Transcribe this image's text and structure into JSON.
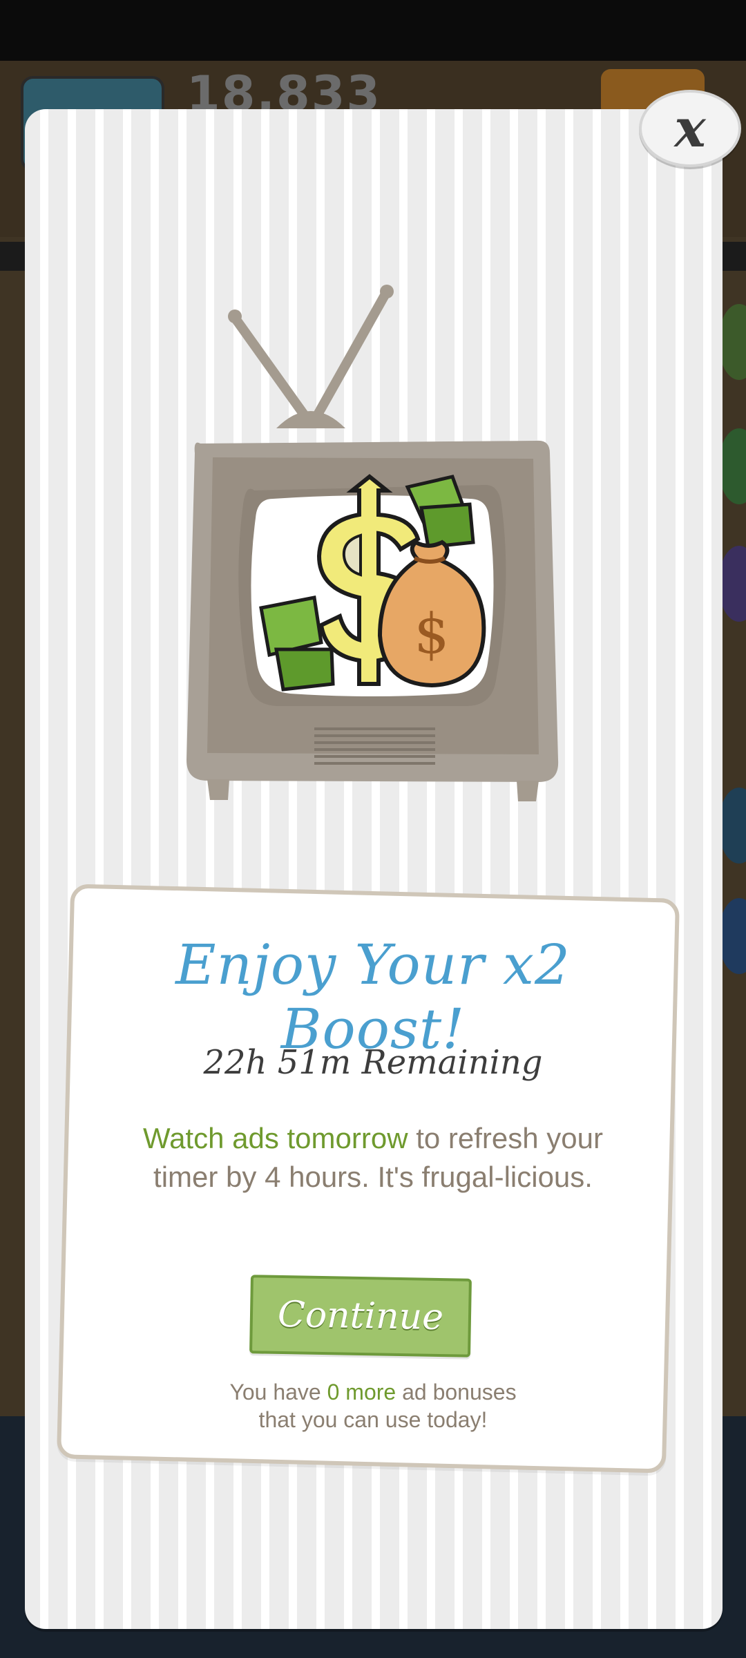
{
  "modal": {
    "close_label": "x",
    "title": "Enjoy Your x2 Boost!",
    "remaining": "22h 51m Remaining",
    "desc_highlight": "Watch ads tomorrow",
    "desc_rest_1": " to refresh your",
    "desc_rest_2": "timer by 4 hours. It's frugal-licious.",
    "continue_label": "Continue",
    "bonus_pre": "You have ",
    "bonus_highlight": "0 more",
    "bonus_post": " ad bonuses",
    "bonus_line2": "that you can use today!"
  },
  "background": {
    "coin_count": "18,833"
  },
  "icons": {
    "tv": "tv-icon",
    "money": "money-bag-icon",
    "close": "close-icon"
  },
  "colors": {
    "title": "#4a9fcf",
    "highlight": "#6f9a2e",
    "button": "#9fc46c"
  }
}
